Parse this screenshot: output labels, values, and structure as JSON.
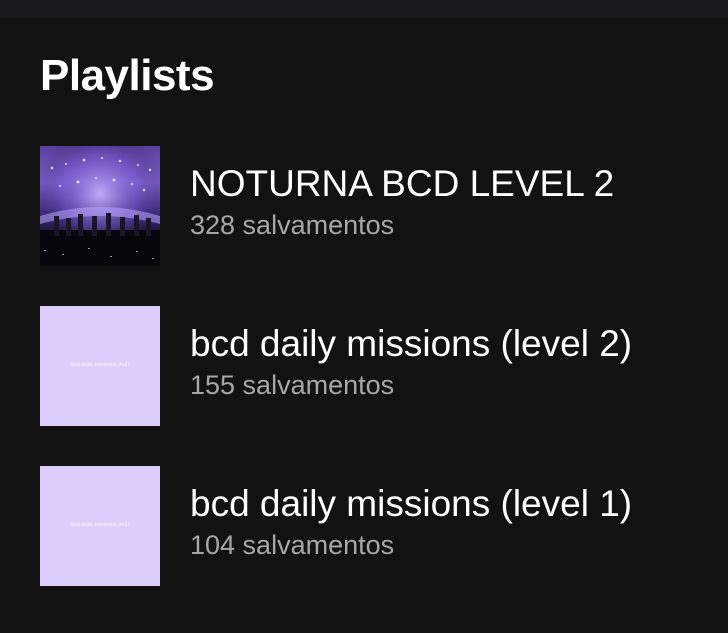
{
  "section": {
    "title": "Playlists"
  },
  "playlists": [
    {
      "title": "NOTURNA BCD LEVEL 2",
      "saves": "328 salvamentos",
      "cover": "concert-stage-photo"
    },
    {
      "title": "bcd daily missions (level 2)",
      "saves": "155 salvamentos",
      "cover": "lilac-square",
      "cover_caption": "bcd daily missions (lv2)"
    },
    {
      "title": "bcd daily missions (level 1)",
      "saves": "104 salvamentos",
      "cover": "lilac-square",
      "cover_caption": "bcd daily missions (lv1)"
    }
  ],
  "colors": {
    "background": "#121212",
    "title_text": "#ffffff",
    "secondary_text": "#a7a7a7",
    "lilac_cover": "#dccdfc"
  }
}
